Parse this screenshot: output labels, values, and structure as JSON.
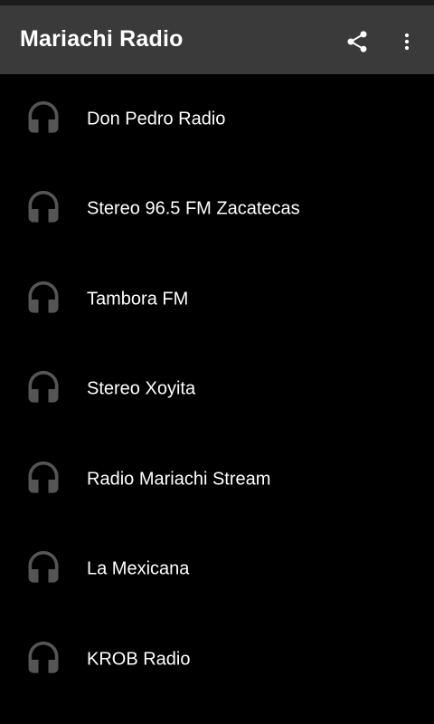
{
  "app_bar": {
    "title": "Mariachi Radio",
    "share_icon": "share-icon",
    "overflow_icon": "more-vert-icon",
    "background": "#3a3a3a"
  },
  "stations": {
    "icon": "headphones-icon",
    "icon_color": "#555555",
    "items": [
      {
        "label": "Don Pedro Radio"
      },
      {
        "label": "Stereo 96.5 FM Zacatecas"
      },
      {
        "label": "Tambora FM"
      },
      {
        "label": "Stereo Xoyita"
      },
      {
        "label": "Radio Mariachi Stream"
      },
      {
        "label": "La Mexicana"
      },
      {
        "label": "KROB Radio"
      }
    ]
  }
}
